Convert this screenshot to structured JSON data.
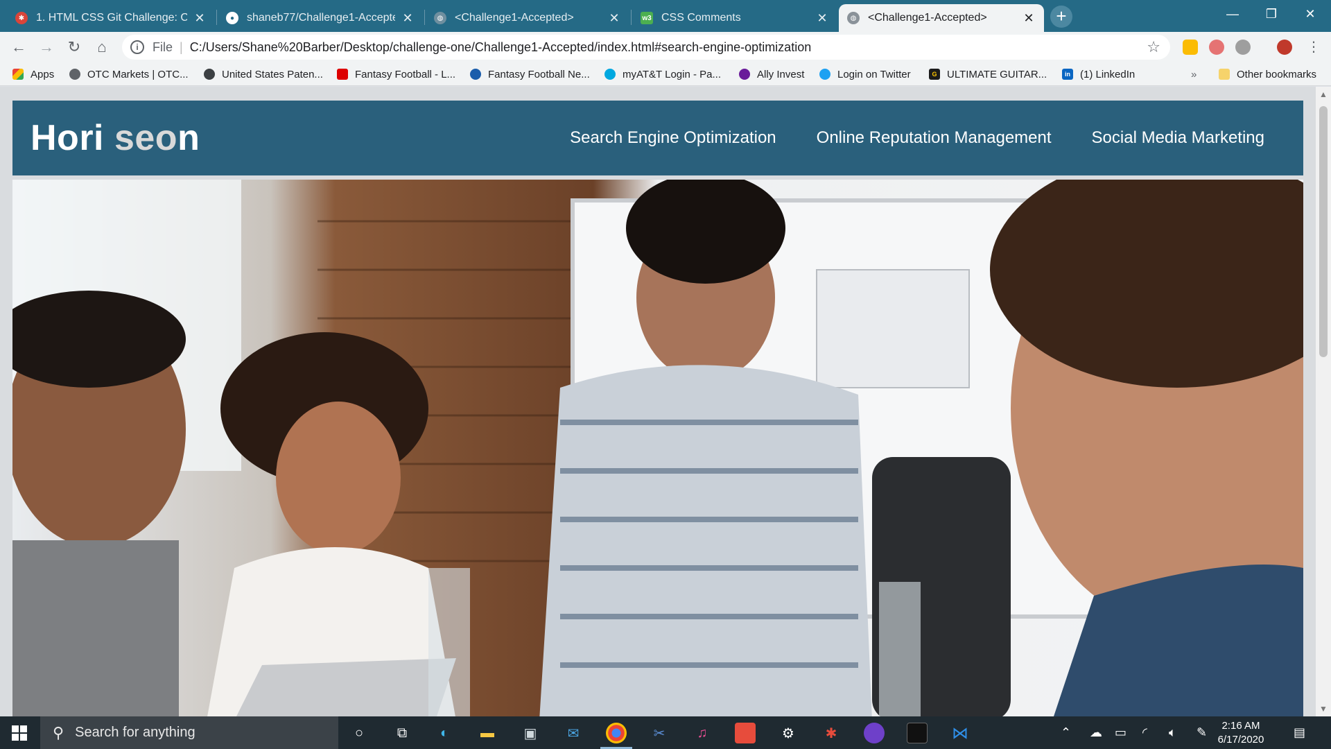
{
  "browser": {
    "tabs": [
      {
        "title": "1. HTML CSS Git Challenge: Code",
        "favicon": "gear-red-icon",
        "active": false
      },
      {
        "title": "shaneb77/Challenge1-Accepted:",
        "favicon": "github-icon",
        "active": false
      },
      {
        "title": "<Challenge1-Accepted>",
        "favicon": "globe-icon",
        "active": false
      },
      {
        "title": "CSS Comments",
        "favicon": "w3-icon",
        "favicon_text": "w3",
        "active": false
      },
      {
        "title": "<Challenge1-Accepted>",
        "favicon": "globe-icon",
        "active": true
      }
    ],
    "address": {
      "scheme": "File",
      "url": "C:/Users/Shane%20Barber/Desktop/challenge-one/Challenge1-Accepted/index.html#search-engine-optimization"
    },
    "bookmarks": [
      {
        "label": "Apps",
        "icon": "apps-grid-icon"
      },
      {
        "label": "OTC Markets | OTC...",
        "icon": "globe-icon"
      },
      {
        "label": "United States Paten...",
        "icon": "lightbulb-icon"
      },
      {
        "label": "Fantasy Football - L...",
        "icon": "espn-icon"
      },
      {
        "label": "Fantasy Football Ne...",
        "icon": "cbs-icon"
      },
      {
        "label": "myAT&T Login - Pa...",
        "icon": "att-icon"
      },
      {
        "label": "Ally Invest",
        "icon": "ally-icon"
      },
      {
        "label": "Login on Twitter",
        "icon": "twitter-icon"
      },
      {
        "label": "ULTIMATE GUITAR...",
        "icon": "ultimate-guitar-icon",
        "icon_text": "G"
      },
      {
        "label": "(1) LinkedIn",
        "icon": "linkedin-icon",
        "icon_text": "in"
      }
    ],
    "bookmarks_overflow": "»",
    "other_bookmarks": "Other bookmarks"
  },
  "site": {
    "logo_part1": "Hori",
    "logo_part2": "seo",
    "logo_part3": "n",
    "nav": [
      {
        "label": "Search Engine Optimization"
      },
      {
        "label": "Online Reputation Management"
      },
      {
        "label": "Social Media Marketing"
      }
    ],
    "hero_image": "team-meeting-photo"
  },
  "taskbar": {
    "search_placeholder": "Search for anything",
    "time": "2:16 AM",
    "date": "6/17/2020"
  },
  "colors": {
    "title_bar": "#256a86",
    "site_header": "#2a607c",
    "taskbar": "#1f2a31"
  }
}
